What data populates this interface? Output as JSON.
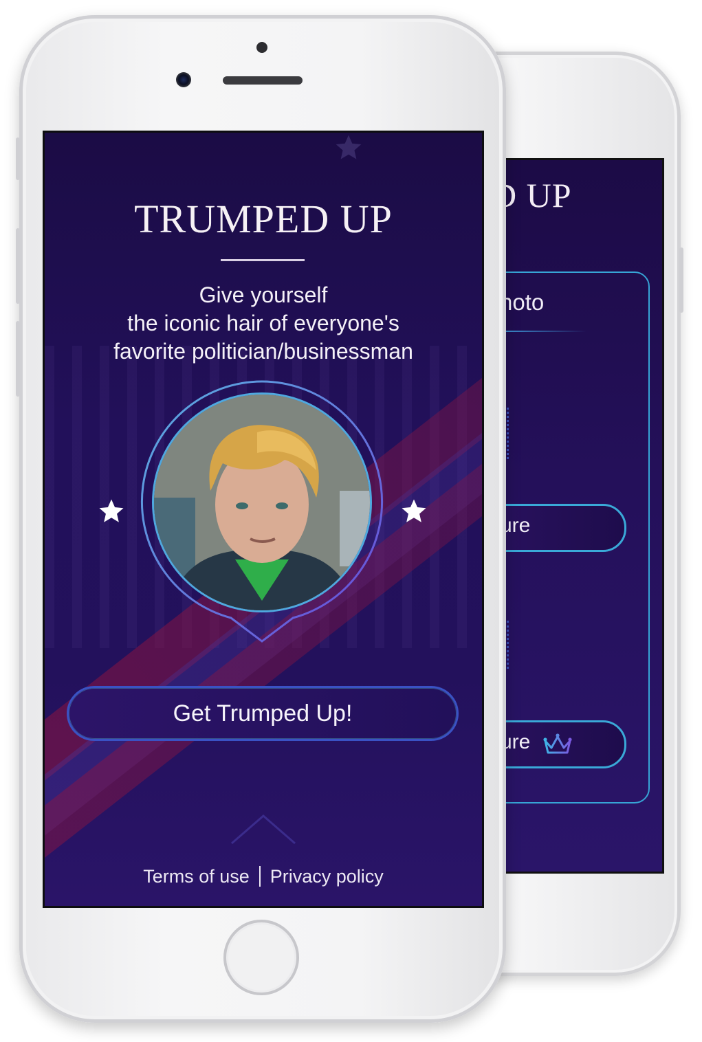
{
  "app": {
    "title": "TRUMPED UP",
    "tagline_lines": [
      "Give yourself",
      "the iconic hair of everyone's",
      "favorite politician/businessman"
    ],
    "cta_label": "Get Trumped Up!",
    "footer": {
      "terms_label": "Terms of use",
      "privacy_label": "Privacy policy"
    }
  },
  "back_screen": {
    "title_fragment": "D UP",
    "card_label_fragment": "hoto",
    "button1_label_fragment": "ure",
    "button2_label_fragment": "ure",
    "button2_icon": "crown-icon"
  },
  "icons": [
    "star-icon",
    "chevron-up-icon",
    "crown-icon",
    "home-button"
  ],
  "colors": {
    "screen_bg": "#22105a",
    "accent_blue": "#3a52c4",
    "accent_cyan": "#3aa9d8",
    "stripe_red": "#96143c",
    "text": "#f5f1f8"
  }
}
